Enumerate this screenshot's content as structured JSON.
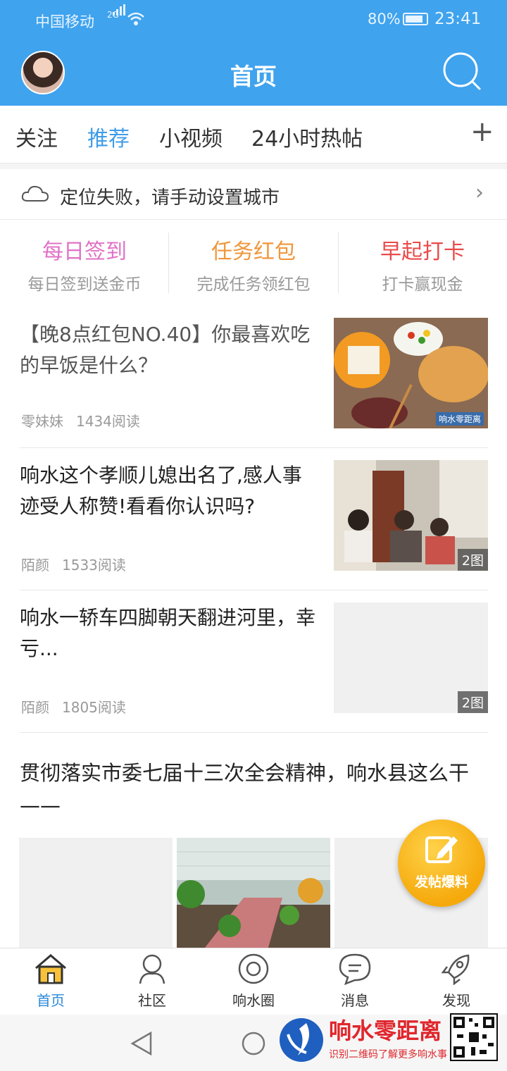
{
  "status_bar": {
    "carrier": "中国移动",
    "network": "2G",
    "battery": "80%",
    "time": "23:41"
  },
  "header": {
    "title": "首页"
  },
  "tabs": [
    {
      "label": "关注",
      "active": false
    },
    {
      "label": "推荐",
      "active": true
    },
    {
      "label": "小视频",
      "active": false
    },
    {
      "label": "24小时热帖",
      "active": false
    }
  ],
  "location": {
    "text": "定位失败，请手动设置城市"
  },
  "quick_actions": [
    {
      "title": "每日签到",
      "subtitle": "每日签到送金币",
      "color": "#e072c6"
    },
    {
      "title": "任务红包",
      "subtitle": "完成任务领红包",
      "color": "#f0963a"
    },
    {
      "title": "早起打卡",
      "subtitle": "打卡赢现金",
      "color": "#ea4a4a"
    }
  ],
  "feed": [
    {
      "title": "【晚8点红包NO.40】你最喜欢吃的早饭是什么？",
      "author": "零妹妹",
      "reads": "1434阅读",
      "image_count": ""
    },
    {
      "title": "响水这个孝顺儿媳出名了,感人事迹受人称赞!看看你认识吗?",
      "author": "陌颜",
      "reads": "1533阅读",
      "image_count": "2图"
    },
    {
      "title": "响水一轿车四脚朝天翻进河里，幸亏...",
      "author": "陌颜",
      "reads": "1805阅读",
      "image_count": "2图"
    }
  ],
  "wide_post": {
    "title": "贯彻落实市委七届十三次全会精神，响水县这么干——"
  },
  "fab": {
    "label": "发帖爆料"
  },
  "bottom_nav": [
    {
      "label": "首页",
      "icon": "home-icon",
      "active": true
    },
    {
      "label": "社区",
      "icon": "community-icon",
      "active": false
    },
    {
      "label": "响水圈",
      "icon": "circle-icon",
      "active": false
    },
    {
      "label": "消息",
      "icon": "message-icon",
      "active": false
    },
    {
      "label": "发现",
      "icon": "rocket-icon",
      "active": false
    }
  ],
  "watermark": {
    "title": "响水零距离",
    "subtitle": "识别二维码了解更多响水事"
  },
  "colors": {
    "brand_blue": "#3fa3ee",
    "active_tab": "#3f9ce8",
    "fab": "#f5a90b"
  }
}
